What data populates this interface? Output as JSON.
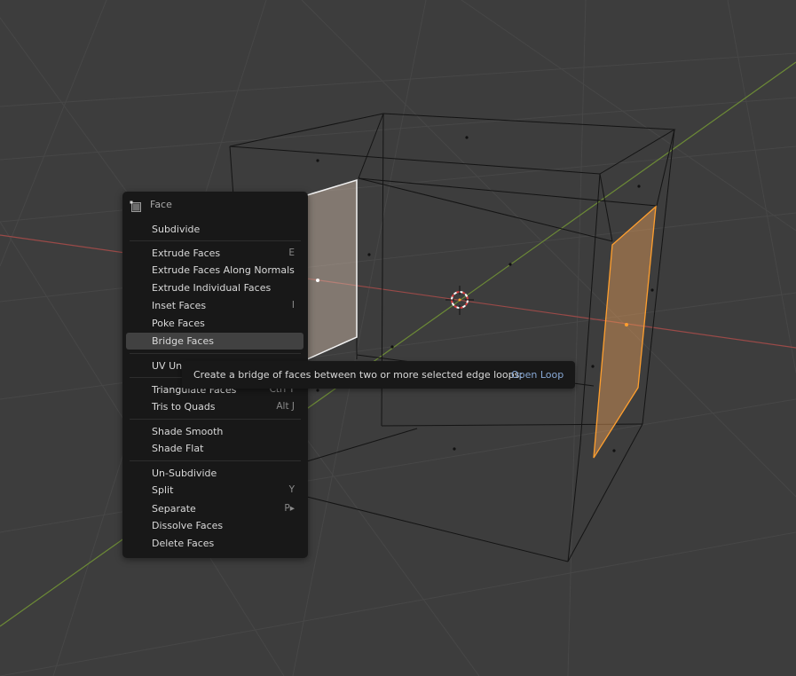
{
  "viewport": {
    "colors": {
      "background": "#3d3d3d",
      "grid": "#474747",
      "x_axis": "#9a4a48",
      "y_axis": "#6c8a36",
      "edge": "#111111",
      "selected_face": "#e8a05a",
      "active_face": "#d6c2b0"
    }
  },
  "menu": {
    "header": {
      "title": "Face",
      "icon": "face-mesh-icon"
    },
    "groups": [
      [
        {
          "label": "Subdivide",
          "shortcut": ""
        }
      ],
      [
        {
          "label": "Extrude Faces",
          "shortcut": "E"
        },
        {
          "label": "Extrude Faces Along Normals",
          "shortcut": ""
        },
        {
          "label": "Extrude Individual Faces",
          "shortcut": ""
        },
        {
          "label": "Inset Faces",
          "shortcut": "I"
        },
        {
          "label": "Poke Faces",
          "shortcut": ""
        },
        {
          "label": "Bridge Faces",
          "shortcut": "",
          "active": true
        }
      ],
      [
        {
          "label": "UV Un",
          "shortcut": ""
        }
      ],
      [
        {
          "label": "Triangulate Faces",
          "shortcut": "Ctrl T"
        },
        {
          "label": "Tris to Quads",
          "shortcut": "Alt J"
        }
      ],
      [
        {
          "label": "Shade Smooth",
          "shortcut": ""
        },
        {
          "label": "Shade Flat",
          "shortcut": ""
        }
      ],
      [
        {
          "label": "Un-Subdivide",
          "shortcut": ""
        },
        {
          "label": "Split",
          "shortcut": "Y"
        },
        {
          "label": "Separate",
          "shortcut": "P▸"
        },
        {
          "label": "Dissolve Faces",
          "shortcut": ""
        },
        {
          "label": "Delete Faces",
          "shortcut": ""
        }
      ]
    ]
  },
  "tooltip": {
    "description": "Create a bridge of faces between two or more selected edge loops:",
    "operator": "Open Loop"
  }
}
